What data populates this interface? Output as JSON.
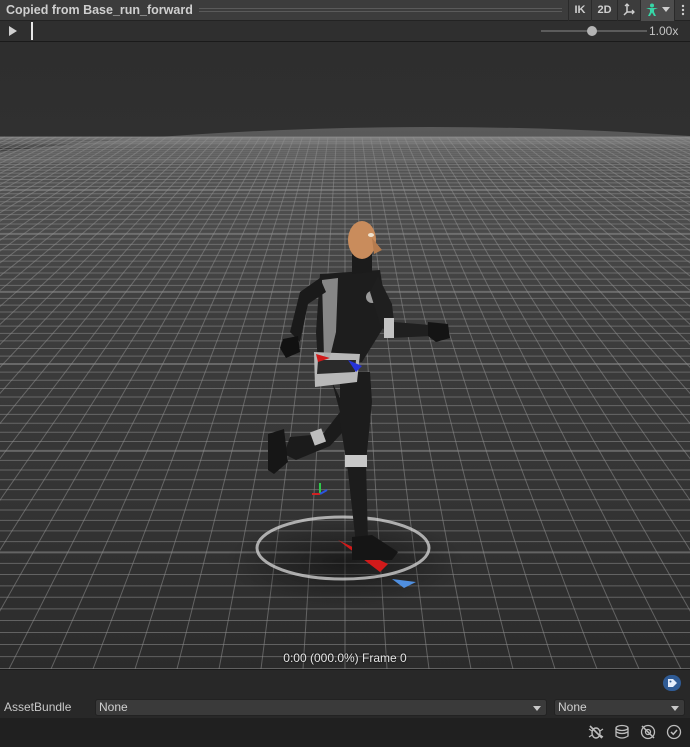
{
  "window": {
    "title": "Copied from Base_run_forward",
    "buttons": {
      "ik": "IK",
      "two_d": "2D"
    }
  },
  "playback": {
    "speed": "1.00x",
    "speed_value": 1.0
  },
  "preview": {
    "time_info": "0:00 (000.0%) Frame 0"
  },
  "asset_bundle": {
    "label": "AssetBundle",
    "name": "None",
    "variant": "None"
  },
  "icons": [
    "pivot-icon",
    "avatar-icon",
    "dropdown-arrow-icon",
    "kebab-menu-icon",
    "play-icon",
    "tag-icon",
    "bug-off-icon",
    "layers-icon",
    "eye-off-icon",
    "check-circle-icon"
  ],
  "colors": {
    "active_button": "#4d4d4d",
    "avatar_icon": "#37d6a7",
    "tag_button": "#2f5b95",
    "floor_grid": "#8e8e8e"
  }
}
